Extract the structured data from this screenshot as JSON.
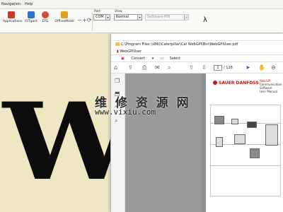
{
  "menubar": {
    "items": [
      "Navigation",
      "Help"
    ]
  },
  "toolbar": {
    "buttons": [
      {
        "label": "Applications",
        "icon": "applications-icon",
        "color": "#c83a2b"
      },
      {
        "label": "IOTgant",
        "icon": "iotgant-icon",
        "color": "#2f6fd0"
      },
      {
        "label": "ETG",
        "icon": "etg-icon",
        "color": "#d24a3a"
      },
      {
        "label": "OfflineMode",
        "icon": "offline-mode-icon",
        "color": "#e0a126"
      }
    ],
    "port": {
      "label": "Port",
      "value": "COM 1"
    },
    "view": {
      "label": "View",
      "value": "Normal"
    },
    "software": {
      "value": "Software-PIN"
    }
  },
  "explorer": {
    "address": "C:\\Program Files (x86)\\Caterpillar\\Cat WebGPI\\Bin\\WebGPIUser.pdf",
    "tab": "WebGPIUser",
    "commands": {
      "convert": "Convert",
      "select": "Select"
    },
    "pdf": {
      "page_current": "1",
      "page_total": "/ 126"
    }
  },
  "document": {
    "brand": "SAUER DANFOSS",
    "cover_lines": [
      "WebGPI",
      "Communication",
      "Software",
      "User Manual"
    ]
  },
  "watermark": {
    "chinese": "维 修 资 源 网",
    "url": "www.vixiu.com"
  },
  "brand_logo": {
    "letter": "W"
  }
}
